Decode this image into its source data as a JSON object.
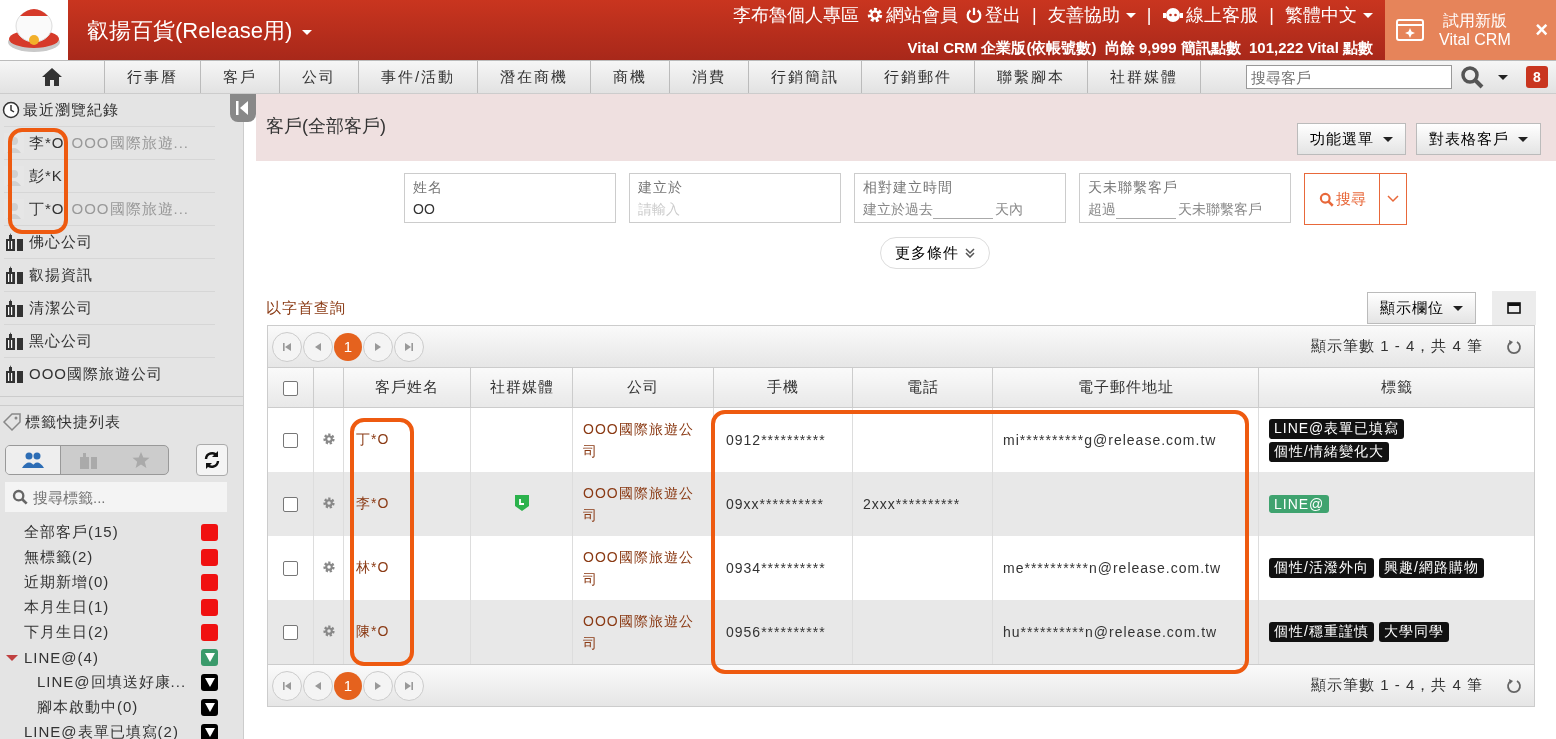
{
  "header": {
    "company_title": "叡揚百貨(Release用)",
    "top_links": [
      {
        "kind": "text",
        "label": "李布魯個人專區"
      },
      {
        "kind": "gear",
        "label": "網站會員"
      },
      {
        "kind": "power",
        "label": "登出"
      },
      {
        "kind": "separator",
        "label": "|"
      },
      {
        "kind": "menu",
        "label": "友善協助"
      },
      {
        "kind": "separator",
        "label": "|"
      },
      {
        "kind": "support",
        "label": "線上客服"
      },
      {
        "kind": "separator",
        "label": "|"
      },
      {
        "kind": "menu",
        "label": "繁體中文"
      }
    ],
    "plan_info": "Vital CRM 企業版(依帳號數)  尚餘 9,999 簡訊點數  101,222 Vital 點數",
    "trial_banner": {
      "line1": "試用新版",
      "line2": "Vital CRM",
      "close": "×"
    }
  },
  "nav": {
    "items": [
      {
        "label": "行事曆",
        "selected": false
      },
      {
        "label": "客戶",
        "selected": false
      },
      {
        "label": "公司",
        "selected": false
      },
      {
        "label": "事件/活動",
        "selected": false
      },
      {
        "label": "潛在商機",
        "selected": false
      },
      {
        "label": "商機",
        "selected": false
      },
      {
        "label": "消費",
        "selected": false
      },
      {
        "label": "行銷簡訊",
        "selected": false
      },
      {
        "label": "行銷郵件",
        "selected": false
      },
      {
        "label": "聯繫腳本",
        "selected": false
      },
      {
        "label": "社群媒體",
        "selected": false
      }
    ],
    "search": {
      "placeholder": "搜尋客戶"
    },
    "notifications": "8"
  },
  "sidebar": {
    "recent_title": "最近瀏覽紀錄",
    "recent": [
      {
        "kind": "person",
        "name": "李*O",
        "company": "OOO國際旅遊..."
      },
      {
        "kind": "person",
        "name": "彭*K"
      },
      {
        "kind": "person",
        "name": "丁*O",
        "company": "OOO國際旅遊..."
      },
      {
        "kind": "company",
        "name": "佛心公司"
      },
      {
        "kind": "company",
        "name": "叡揚資訊"
      },
      {
        "kind": "company",
        "name": "清潔公司"
      },
      {
        "kind": "company",
        "name": "黑心公司"
      },
      {
        "kind": "company",
        "name": "OOO國際旅遊公司"
      }
    ],
    "tags_title": "標籤快捷列表",
    "tag_tabs": [
      {
        "kind": "people",
        "selected": true
      },
      {
        "kind": "company",
        "selected": false
      },
      {
        "kind": "star",
        "selected": false
      }
    ],
    "tag_search": {
      "placeholder": "搜尋標籤..."
    },
    "tags": [
      {
        "label": "全部客戶(15)",
        "kind": "square",
        "color": "#f01010"
      },
      {
        "label": "無標籤(2)",
        "kind": "square",
        "color": "#f01010"
      },
      {
        "label": "近期新增(0)",
        "kind": "square",
        "color": "#f01010"
      },
      {
        "label": "本月生日(1)",
        "kind": "square",
        "color": "#f01010"
      },
      {
        "label": "下月生日(2)",
        "kind": "square",
        "color": "#f01010"
      },
      {
        "label": "LINE@(4)",
        "kind": "triangle",
        "color": "#3a9a6b",
        "expanded": true,
        "children": [
          {
            "label": "LINE@回填送好康...",
            "kind": "triangle",
            "color": "#000000"
          },
          {
            "label": "腳本啟動中(0)",
            "kind": "triangle",
            "color": "#000000"
          }
        ]
      },
      {
        "label": "LINE@表單已填寫(2)",
        "kind": "triangle",
        "color": "#000000"
      }
    ]
  },
  "main": {
    "page_title": "客戶(全部客戶)",
    "action_buttons": [
      "功能選單",
      "對表格客戶"
    ],
    "filters": [
      {
        "kind": "text",
        "label": "姓名",
        "value": "OO"
      },
      {
        "kind": "text",
        "label": "建立於",
        "placeholder": "請輸入"
      },
      {
        "kind": "days",
        "label": "相對建立時間",
        "prefix": "建立於過去",
        "suffix": "天內"
      },
      {
        "kind": "days",
        "label": "天未聯繫客戶",
        "prefix": "超過",
        "suffix": "天未聯繫客戶"
      }
    ],
    "search_button": "搜尋",
    "more_conditions": "更多條件",
    "alpha_link": "以字首查詢",
    "columns_button": "顯示欄位",
    "pager_top": {
      "pages": [
        {
          "label": "1",
          "selected": true
        }
      ],
      "summary": "顯示筆數 1 - 4，共 4 筆"
    },
    "all_checked": false,
    "columns": [
      "客戶姓名",
      "社群媒體",
      "公司",
      "手機",
      "電話",
      "電子郵件地址",
      "標籤"
    ],
    "rows": [
      {
        "checked": false,
        "name": "丁*O",
        "line": false,
        "company": "OOO國際旅遊公司",
        "mobile": "0912**********",
        "phone": "",
        "email": "mi**********g@release.com.tw",
        "tags": [
          {
            "label": "LINE@表單已填寫",
            "color": "#111111"
          },
          {
            "label": "個性/情緒變化大",
            "color": "#111111"
          }
        ]
      },
      {
        "checked": false,
        "name": "李*O",
        "line": true,
        "company": "OOO國際旅遊公司",
        "mobile": "09xx**********",
        "phone": "2xxx**********",
        "email": "",
        "tags": [
          {
            "label": "LINE@",
            "color": "#3fa36f"
          }
        ]
      },
      {
        "checked": false,
        "name": "林*O",
        "line": false,
        "company": "OOO國際旅遊公司",
        "mobile": "0934**********",
        "phone": "",
        "email": "me**********n@release.com.tw",
        "tags": [
          {
            "label": "個性/活潑外向",
            "color": "#111111"
          },
          {
            "label": "興趣/網路購物",
            "color": "#111111"
          }
        ]
      },
      {
        "checked": false,
        "name": "陳*O",
        "line": false,
        "company": "OOO國際旅遊公司",
        "mobile": "0956**********",
        "phone": "",
        "email": "hu**********n@release.com.tw",
        "tags": [
          {
            "label": "個性/穩重謹慎",
            "color": "#111111"
          },
          {
            "label": "大學同學",
            "color": "#111111"
          }
        ]
      }
    ],
    "pager_bottom": {
      "pages": [
        {
          "label": "1",
          "selected": true
        }
      ],
      "summary": "顯示筆數 1 - 4，共 4 筆"
    }
  }
}
